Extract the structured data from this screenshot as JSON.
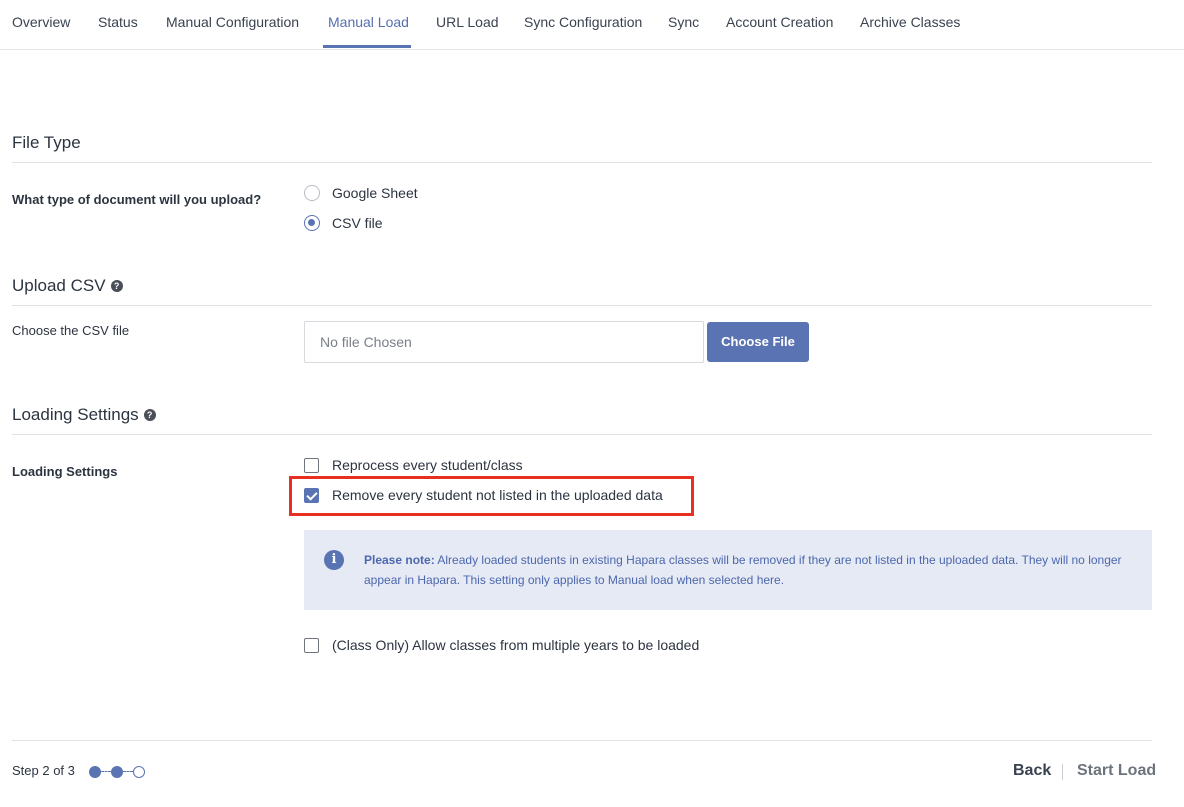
{
  "tabs": [
    {
      "label": "Overview",
      "active": false
    },
    {
      "label": "Status",
      "active": false
    },
    {
      "label": "Manual Configuration",
      "active": false
    },
    {
      "label": "Manual Load",
      "active": true
    },
    {
      "label": "URL Load",
      "active": false
    },
    {
      "label": "Sync Configuration",
      "active": false
    },
    {
      "label": "Sync",
      "active": false
    },
    {
      "label": "Account Creation",
      "active": false
    },
    {
      "label": "Archive Classes",
      "active": false
    }
  ],
  "file_type": {
    "title": "File Type",
    "question": "What type of document will you upload?",
    "options": [
      {
        "label": "Google Sheet",
        "selected": false
      },
      {
        "label": "CSV file",
        "selected": true
      }
    ]
  },
  "upload_csv": {
    "title": "Upload CSV",
    "help_icon": "question-circle-icon",
    "label": "Choose the CSV file",
    "file_placeholder": "No file Chosen",
    "choose_button": "Choose File"
  },
  "loading_settings": {
    "title": "Loading Settings",
    "help_icon": "question-circle-icon",
    "label": "Loading Settings",
    "options": [
      {
        "label": "Reprocess every student/class",
        "checked": false
      },
      {
        "label": "Remove every student not listed in the uploaded data",
        "checked": true
      },
      {
        "label": "(Class Only) Allow classes from multiple years to be loaded",
        "checked": false
      }
    ],
    "note": {
      "icon": "info-icon",
      "bold": "Please note:",
      "text": " Already loaded students in existing Hapara classes will be removed if they are not listed in the uploaded data. They will no longer appear in Hapara. This setting only applies to Manual load when selected here."
    }
  },
  "footer": {
    "step_text": "Step 2 of 3",
    "steps_total": 3,
    "steps_completed": 2,
    "back_label": "Back",
    "start_label": "Start Load"
  },
  "colors": {
    "accent": "#5a73b3",
    "highlight_border": "#e8301f",
    "note_background": "#e6eaf5"
  }
}
